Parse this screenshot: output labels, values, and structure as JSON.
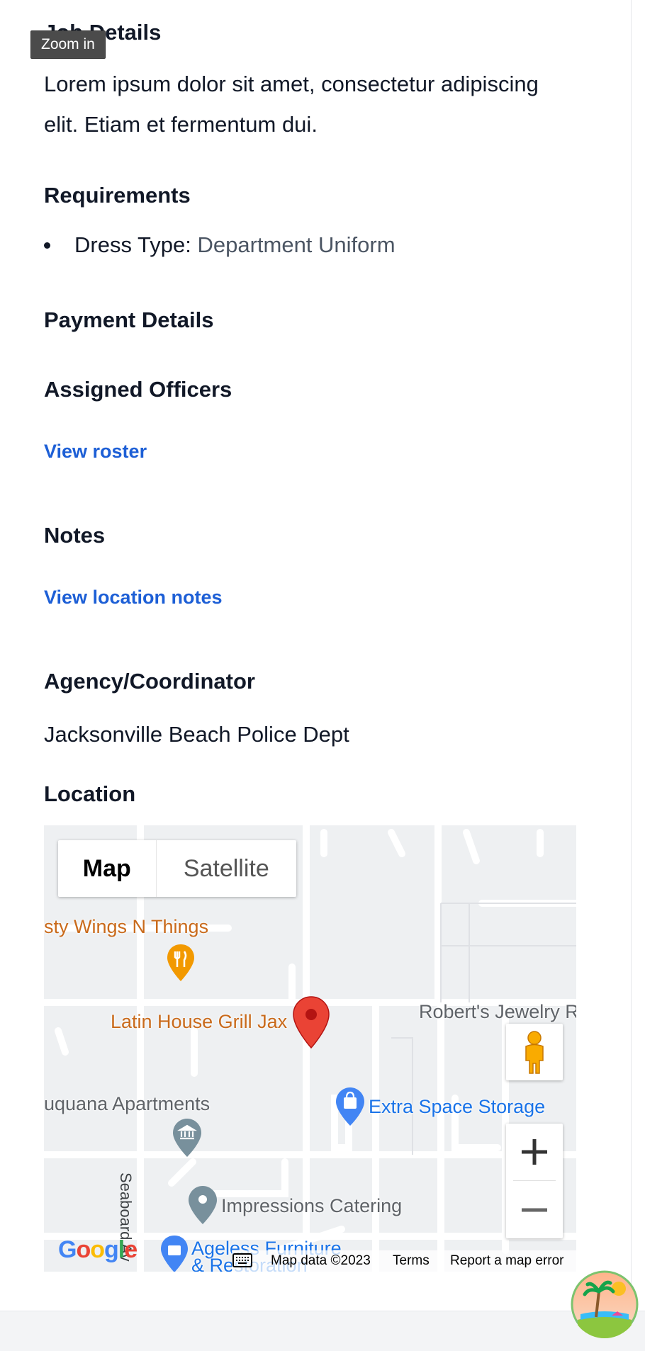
{
  "tooltip": "Zoom in",
  "sections": {
    "job_details_heading": "Job Details",
    "job_description": "Lorem ipsum dolor sit amet, consectetur adipiscing elit. Etiam et fermentum dui.",
    "requirements_heading": "Requirements",
    "requirement_label": "Dress Type:",
    "requirement_value": "Department Uniform",
    "payment_heading": "Payment Details",
    "officers_heading": "Assigned Officers",
    "view_roster_link": "View roster",
    "notes_heading": "Notes",
    "view_notes_link": "View location notes",
    "agency_heading": "Agency/Coordinator",
    "agency_name": "Jacksonville Beach Police Dept",
    "location_heading": "Location"
  },
  "map": {
    "type_map": "Map",
    "type_satellite": "Satellite",
    "pois": {
      "wings": "sty Wings N Things",
      "latin": "Latin House Grill Jax",
      "jewelry": "Robert's Jewelry R",
      "apartments": "uquana Apartments",
      "storage": "Extra Space Storage",
      "catering": "Impressions Catering",
      "furniture": "Ageless Furniture",
      "furniture2": "& Restoration"
    },
    "street": "Seaboard Av",
    "google_logo": "Google",
    "map_data": "Map data ©2023",
    "terms": "Terms",
    "report_error": "Report a map error",
    "icons": [
      "restaurant-pin-icon",
      "red-marker-icon",
      "shopping-pin-icon",
      "museum-pin-icon",
      "place-pin-icon",
      "pegman-icon",
      "zoom-in-icon",
      "zoom-out-icon",
      "keyboard-icon"
    ],
    "colors": {
      "marker": "#ea4335",
      "poi_orange": "#f29900",
      "poi_blue": "#4285f4",
      "poi_gray": "#78909c"
    }
  },
  "colors": {
    "link": "#1d5fd6",
    "heading": "#111827"
  }
}
